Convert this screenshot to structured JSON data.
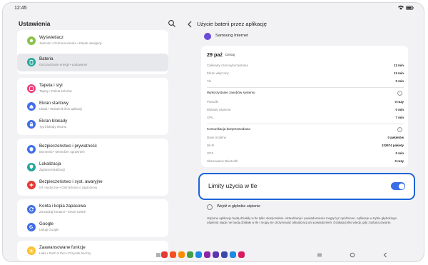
{
  "status": {
    "time": "12:45"
  },
  "left": {
    "title": "Ustawienia",
    "items": [
      {
        "title": "Wyświetlacz",
        "sub": "Jasność • Ochrona wzroku • Pasek nawigacji",
        "icon": "display-icon",
        "color": "#8bc34a"
      },
      {
        "title": "Bateria",
        "sub": "Oszczędzanie energii • Ładowanie",
        "icon": "battery-icon",
        "color": "#26a69a"
      },
      {
        "title": "Tapeta i styl",
        "sub": "Tapety • Paleta kolorów",
        "icon": "wallpaper-icon",
        "color": "#ec407a"
      },
      {
        "title": "Ekran startowy",
        "sub": "Układ • Wskaźnik ikon aplikacji",
        "icon": "home-icon",
        "color": "#3f6ee8"
      },
      {
        "title": "Ekran blokady",
        "sub": "Typ blokady ekranu",
        "icon": "lock-icon",
        "color": "#3f6ee8"
      },
      {
        "title": "Bezpieczeństwo i prywatność",
        "sub": "Biometria • Menedżer uprawnień",
        "icon": "shield-icon",
        "color": "#3f6ee8"
      },
      {
        "title": "Lokalizacja",
        "sub": "Żądania lokalizacji",
        "icon": "location-icon",
        "color": "#26a69a"
      },
      {
        "title": "Bezpieczeństwo i syst. awaryjne",
        "sub": "Inf. medyczne • Ostrzeżenia o zagrożeniu",
        "icon": "emergency-icon",
        "color": "#e53935"
      },
      {
        "title": "Konta i kopia zapasowa",
        "sub": "Zarządzaj kontami • Smart Switch",
        "icon": "sync-icon",
        "color": "#3f6ee8"
      },
      {
        "title": "Google",
        "sub": "Usługi Google",
        "icon": "google-icon",
        "color": "#3f6ee8"
      },
      {
        "title": "Zaawansowane funkcje",
        "sub": "Labs • Ruch S Pen • Przycisk boczny",
        "icon": "advanced-icon",
        "color": "#fbc02d"
      }
    ]
  },
  "right": {
    "title": "Użycie baterii przez aplikację",
    "app_name": "Samsung Internet",
    "date": "29 paź",
    "date_sub": "Dzisiaj",
    "usage": [
      {
        "label": "Całkowity czas wykorzystania",
        "value": "12 min"
      },
      {
        "label": "Ekran włączony",
        "value": "12 min"
      },
      {
        "label": "Tło",
        "value": "0 min"
      }
    ],
    "resources_title": "Wykorzystanie zasobów systemu",
    "resources": [
      {
        "label": "Pobudki",
        "value": "0 razy"
      },
      {
        "label": "Blokady uśpienia",
        "value": "0 min"
      },
      {
        "label": "CPU",
        "value": "7 min"
      }
    ],
    "wireless_title": "Komunikacja bezprzewodowa",
    "wireless": [
      {
        "label": "Dane mobilne",
        "value": "0 pakietów"
      },
      {
        "label": "Wi-Fi",
        "value": "132674 pakiety"
      },
      {
        "label": "GPS",
        "value": "0 min"
      },
      {
        "label": "Skanowanie Bluetooth",
        "value": "0 razy"
      }
    ],
    "limit_label": "Limity użycia w tle",
    "deep_sleep_label": "Wejdź w głębokie uśpienie",
    "description": "Uśpione aplikacje będą działały w tle tylko okazjonalnie. Aktualizacje i powiadomienia mogą być opóźnione. Aplikacje w trybie głębokiego uśpienia nigdy nie będą działały w tle i mogą nie otrzymywać aktualizacji ani powiadomień. Działają tylko wtedy, gdy zostaną otwarte."
  },
  "dock_colors": [
    "#e53935",
    "#f4511e",
    "#fb8c00",
    "#43a047",
    "#1e88e5",
    "#8e24aa",
    "#5e35b1",
    "#3949ab",
    "#1e88e5",
    "#d81b60"
  ]
}
